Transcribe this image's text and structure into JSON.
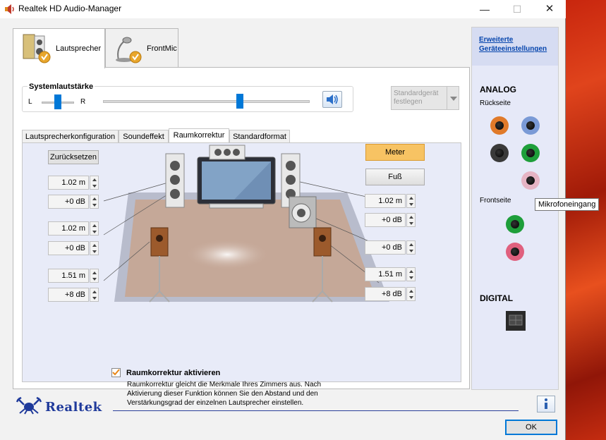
{
  "window": {
    "title": "Realtek HD Audio-Manager"
  },
  "main_tabs": [
    {
      "label": "Lautsprecher",
      "active": true
    },
    {
      "label": "FrontMic",
      "active": false
    }
  ],
  "system_volume": {
    "title": "Systemlautstärke",
    "balance_left": "L",
    "balance_right": "R",
    "balance_level": 0.5,
    "volume_level": 0.66,
    "default_device_label": "Standardgerät festlegen"
  },
  "sub_tabs": [
    {
      "label": "Lautsprecherkonfiguration",
      "active": false
    },
    {
      "label": "Soundeffekt",
      "active": false
    },
    {
      "label": "Raumkorrektur",
      "active": true
    },
    {
      "label": "Standardformat",
      "active": false
    }
  ],
  "room_correction": {
    "reset_label": "Zurücksetzen",
    "unit_meter_label": "Meter",
    "unit_foot_label": "Fuß",
    "left_fields": [
      {
        "distance": "1.02 m",
        "gain": "+0 dB"
      },
      {
        "distance": "1.02 m",
        "gain": "+0 dB"
      },
      {
        "distance": "1.51 m",
        "gain": "+8 dB"
      }
    ],
    "right_fields": [
      {
        "distance": "1.02 m",
        "gain": "+0 dB"
      },
      {
        "gain": "+0 dB"
      },
      {
        "distance": "1.51 m",
        "gain": "+8 dB"
      }
    ],
    "enable_checked": true,
    "enable_label": "Raumkorrektur aktivieren",
    "enable_description": "Raumkorrektur gleicht die Merkmale Ihres Zimmers aus. Nach Aktivierung dieser Funktion können Sie den Abstand und den Verstärkungsgrad der einzelnen Lautsprecher einstellen."
  },
  "right_panel": {
    "advanced_link": "Erweiterte Geräteeinstellungen",
    "analog_title": "ANALOG",
    "rear_label": "Rückseite",
    "front_label": "Frontseite",
    "digital_title": "DIGITAL",
    "tooltip": "Mikrofoneingang",
    "rear_jacks": [
      {
        "name": "orange",
        "color": "#e07a2a"
      },
      {
        "name": "blue",
        "color": "#7a9ad6"
      },
      {
        "name": "black",
        "color": "#3a3a3a"
      },
      {
        "name": "green",
        "color": "#1e9e3a"
      },
      {
        "name": "pink-inactive",
        "color": "#e6b4c4"
      }
    ],
    "front_jacks": [
      {
        "name": "green",
        "color": "#1e9e3a"
      },
      {
        "name": "pink",
        "color": "#e0607e"
      }
    ]
  },
  "footer": {
    "brand": "Realtek",
    "ok_label": "OK"
  },
  "colors": {
    "accent_blue": "#0078d7",
    "meter_active": "#f7c363",
    "floor": "#c5a898",
    "realtek_blue": "#1f3a9b"
  }
}
